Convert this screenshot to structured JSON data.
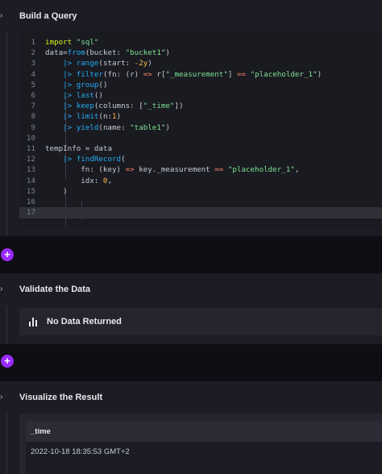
{
  "query": {
    "title": "Build a Query",
    "lines": [
      {
        "n": "1",
        "tokens": [
          [
            "kw",
            "import "
          ],
          [
            "str",
            "\"sql\""
          ]
        ]
      },
      {
        "n": "2",
        "tokens": [
          [
            "plain",
            "data="
          ],
          [
            "fn",
            "from"
          ],
          [
            "plain",
            "(bucket: "
          ],
          [
            "str",
            "\"bucket1\""
          ],
          [
            "plain",
            ")"
          ]
        ]
      },
      {
        "n": "3",
        "tokens": [
          [
            "pipe",
            "    |> "
          ],
          [
            "fn",
            "range"
          ],
          [
            "plain",
            "(start: "
          ],
          [
            "num",
            "-2y"
          ],
          [
            "plain",
            ")"
          ]
        ]
      },
      {
        "n": "4",
        "tokens": [
          [
            "pipe",
            "    |> "
          ],
          [
            "fn",
            "filter"
          ],
          [
            "plain",
            "(fn: (r) "
          ],
          [
            "op",
            "=>"
          ],
          [
            "plain",
            " r["
          ],
          [
            "str",
            "\"_measurement\""
          ],
          [
            "plain",
            "] "
          ],
          [
            "op",
            "=="
          ],
          [
            "plain",
            " "
          ],
          [
            "str",
            "\"placeholder_1\""
          ],
          [
            "plain",
            ")"
          ]
        ]
      },
      {
        "n": "5",
        "tokens": [
          [
            "pipe",
            "    |> "
          ],
          [
            "fn",
            "group"
          ],
          [
            "plain",
            "()"
          ]
        ]
      },
      {
        "n": "6",
        "tokens": [
          [
            "pipe",
            "    |> "
          ],
          [
            "fn",
            "last"
          ],
          [
            "plain",
            "()"
          ]
        ]
      },
      {
        "n": "7",
        "tokens": [
          [
            "pipe",
            "    |> "
          ],
          [
            "fn",
            "keep"
          ],
          [
            "plain",
            "(columns: ["
          ],
          [
            "str",
            "\"_time\""
          ],
          [
            "plain",
            "])"
          ]
        ]
      },
      {
        "n": "8",
        "tokens": [
          [
            "pipe",
            "    |> "
          ],
          [
            "fn",
            "limit"
          ],
          [
            "plain",
            "(n:"
          ],
          [
            "num",
            "1"
          ],
          [
            "plain",
            ")"
          ]
        ]
      },
      {
        "n": "9",
        "tokens": [
          [
            "pipe",
            "    |> "
          ],
          [
            "fn",
            "yield"
          ],
          [
            "plain",
            "(name: "
          ],
          [
            "str",
            "\"table1\""
          ],
          [
            "plain",
            ")"
          ]
        ]
      },
      {
        "n": "10",
        "tokens": []
      },
      {
        "n": "11",
        "tokens": [
          [
            "plain",
            "tempInfo = data"
          ]
        ]
      },
      {
        "n": "12",
        "tokens": [
          [
            "pipe",
            "    |> "
          ],
          [
            "fn",
            "findRecord"
          ],
          [
            "plain",
            "("
          ]
        ]
      },
      {
        "n": "13",
        "tokens": [
          [
            "plain",
            "        fn: (key) "
          ],
          [
            "op",
            "=>"
          ],
          [
            "plain",
            " key._measurement "
          ],
          [
            "op",
            "=="
          ],
          [
            "plain",
            " "
          ],
          [
            "str",
            "\"placeholder_1\""
          ],
          [
            "plain",
            ","
          ]
        ]
      },
      {
        "n": "14",
        "tokens": [
          [
            "plain",
            "        idx: "
          ],
          [
            "num",
            "0"
          ],
          [
            "plain",
            ","
          ]
        ]
      },
      {
        "n": "15",
        "tokens": [
          [
            "plain",
            "    )"
          ]
        ]
      },
      {
        "n": "16",
        "tokens": []
      },
      {
        "n": "17",
        "tokens": []
      }
    ]
  },
  "validate": {
    "title": "Validate the Data",
    "empty_text": "No Data Returned"
  },
  "visualize": {
    "title": "Visualize the Result",
    "columns": [
      "_time"
    ],
    "rows": [
      [
        "2022-10-18 18:35:53 GMT+2"
      ]
    ]
  },
  "buttons": {
    "add_label": "+",
    "collapse_label": "›"
  },
  "icons": {
    "collapse": "chevron-right-icon",
    "add": "plus-icon",
    "empty": "bar-chart-icon"
  },
  "colors": {
    "accent": "#9b2aff",
    "keyword": "#d6f622",
    "function": "#22adf6",
    "string": "#7ce490",
    "operator": "#ff8564",
    "number": "#ffb94a"
  }
}
